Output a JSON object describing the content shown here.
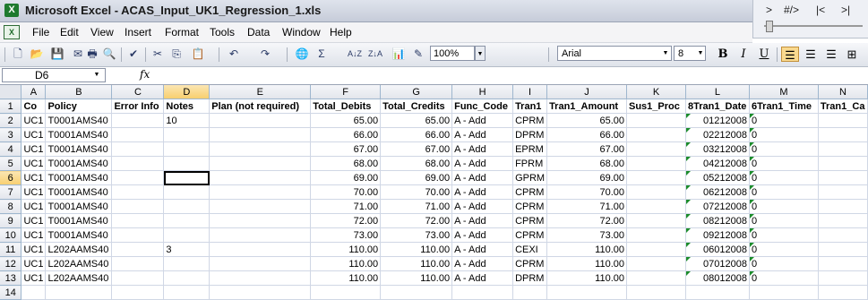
{
  "window": {
    "title": "Microsoft Excel - ACAS_Input_UK1_Regression_1.xls",
    "app_icon": "X"
  },
  "float_toolbar": {
    "items": [
      ">",
      "#/>",
      "|<",
      ">|"
    ]
  },
  "menu": {
    "items": [
      {
        "label": "File"
      },
      {
        "label": "Edit"
      },
      {
        "label": "View"
      },
      {
        "label": "Insert"
      },
      {
        "label": "Format"
      },
      {
        "label": "Tools"
      },
      {
        "label": "Data"
      },
      {
        "label": "Window"
      },
      {
        "label": "Help"
      }
    ]
  },
  "toolbar": {
    "zoom": "100%",
    "font": "Arial",
    "font_size": "8",
    "bold": "B",
    "italic": "I",
    "underline": "U",
    "sigma": "Σ",
    "sort_asc": "A↓Z",
    "sort_desc": "Z↓A"
  },
  "formula_bar": {
    "cell_ref": "D6",
    "fx": "fx",
    "content": ""
  },
  "sheet": {
    "selected_cell": "D6",
    "columns": [
      "A",
      "B",
      "C",
      "D",
      "E",
      "F",
      "G",
      "H",
      "I",
      "J",
      "K",
      "L",
      "M",
      "N"
    ],
    "header_row": [
      "Co",
      "Policy",
      "Error Info",
      "Notes",
      "Plan (not required)",
      "Total_Debits",
      "Total_Credits",
      "Func_Code",
      "Tran1",
      "Tran1_Amount",
      "Sus1_Proc",
      "8Tran1_Date",
      "6Tran1_Time",
      "Tran1_Ca"
    ],
    "rows": [
      [
        "UC1",
        "T0001AMS40",
        "",
        "10",
        "",
        "65.00",
        "65.00",
        "A - Add",
        "CPRM",
        "65.00",
        "",
        "01212008",
        "0",
        ""
      ],
      [
        "UC1",
        "T0001AMS40",
        "",
        "",
        "",
        "66.00",
        "66.00",
        "A - Add",
        "DPRM",
        "66.00",
        "",
        "02212008",
        "0",
        ""
      ],
      [
        "UC1",
        "T0001AMS40",
        "",
        "",
        "",
        "67.00",
        "67.00",
        "A - Add",
        "EPRM",
        "67.00",
        "",
        "03212008",
        "0",
        ""
      ],
      [
        "UC1",
        "T0001AMS40",
        "",
        "",
        "",
        "68.00",
        "68.00",
        "A - Add",
        "FPRM",
        "68.00",
        "",
        "04212008",
        "0",
        ""
      ],
      [
        "UC1",
        "T0001AMS40",
        "",
        "",
        "",
        "69.00",
        "69.00",
        "A - Add",
        "GPRM",
        "69.00",
        "",
        "05212008",
        "0",
        ""
      ],
      [
        "UC1",
        "T0001AMS40",
        "",
        "",
        "",
        "70.00",
        "70.00",
        "A - Add",
        "CPRM",
        "70.00",
        "",
        "06212008",
        "0",
        ""
      ],
      [
        "UC1",
        "T0001AMS40",
        "",
        "",
        "",
        "71.00",
        "71.00",
        "A - Add",
        "CPRM",
        "71.00",
        "",
        "07212008",
        "0",
        ""
      ],
      [
        "UC1",
        "T0001AMS40",
        "",
        "",
        "",
        "72.00",
        "72.00",
        "A - Add",
        "CPRM",
        "72.00",
        "",
        "08212008",
        "0",
        ""
      ],
      [
        "UC1",
        "T0001AMS40",
        "",
        "",
        "",
        "73.00",
        "73.00",
        "A - Add",
        "CPRM",
        "73.00",
        "",
        "09212008",
        "0",
        ""
      ],
      [
        "UC1",
        "L202AAMS40",
        "",
        "3",
        "",
        "110.00",
        "110.00",
        "A - Add",
        "CEXI",
        "110.00",
        "",
        "06012008",
        "0",
        ""
      ],
      [
        "UC1",
        "L202AAMS40",
        "",
        "",
        "",
        "110.00",
        "110.00",
        "A - Add",
        "CPRM",
        "110.00",
        "",
        "07012008",
        "0",
        ""
      ],
      [
        "UC1",
        "L202AAMS40",
        "",
        "",
        "",
        "110.00",
        "110.00",
        "A - Add",
        "DPRM",
        "110.00",
        "",
        "08012008",
        "0",
        ""
      ],
      [
        "",
        "",
        "",
        "",
        "",
        "",
        "",
        "",
        "",
        "",
        "",
        "",
        "",
        ""
      ]
    ]
  }
}
